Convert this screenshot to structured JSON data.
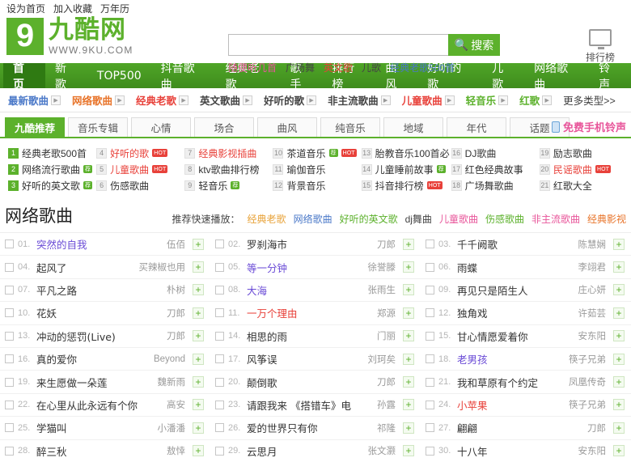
{
  "topbar": {
    "links": [
      "设为首页",
      "加入收藏",
      "万年历"
    ]
  },
  "logo": {
    "mark": "9",
    "cn": "九酷网",
    "en": "WWW.9KU.COM"
  },
  "search": {
    "value": "",
    "placeholder": "",
    "button_label": "搜索",
    "button_icon": "search-icon",
    "hotwords": [
      {
        "label": "随便听几首",
        "color": "#e8559a"
      },
      {
        "label": "广场舞",
        "color": "#444444"
      },
      {
        "label": "英文歌",
        "color": "#e8413a"
      },
      {
        "label": "儿歌",
        "color": "#444444"
      },
      {
        "label": "经典老歌500首",
        "color": "#4a78c8"
      }
    ]
  },
  "rank": {
    "icon": "monitor-icon",
    "label": "排行榜"
  },
  "mainnav": {
    "items": [
      {
        "label": "首页",
        "active": true
      },
      {
        "label": "新歌",
        "active": false
      },
      {
        "label": "TOP500",
        "active": false
      },
      {
        "label": "抖音歌曲",
        "active": false
      },
      {
        "label": "经典老歌",
        "active": false
      },
      {
        "label": "歌手",
        "active": false
      },
      {
        "label": "排行榜",
        "active": false
      },
      {
        "label": "曲风",
        "active": false
      },
      {
        "label": "好听的歌",
        "active": false
      },
      {
        "label": "儿歌",
        "active": false
      },
      {
        "label": "网络歌曲",
        "active": false
      },
      {
        "label": "铃声",
        "active": false
      }
    ]
  },
  "subnav": {
    "items": [
      {
        "label": "最新歌曲",
        "color": "#4a78c8",
        "icon": "play-icon"
      },
      {
        "label": "网络歌曲",
        "color": "#e8742a",
        "icon": "play-icon"
      },
      {
        "label": "经典老歌",
        "color": "#e8413a",
        "icon": "play-icon"
      },
      {
        "label": "英文歌曲",
        "color": "#444444",
        "icon": "play-icon"
      },
      {
        "label": "好听的歌",
        "color": "#444444",
        "icon": "play-icon"
      },
      {
        "label": "非主流歌曲",
        "color": "#444444",
        "icon": "play-icon"
      },
      {
        "label": "儿童歌曲",
        "color": "#e8413a",
        "icon": "play-icon"
      },
      {
        "label": "轻音乐",
        "color": "#5cb12c",
        "icon": "play-icon"
      },
      {
        "label": "红歌",
        "color": "#5cb12c",
        "icon": "play-icon"
      }
    ],
    "more": "更多类型>>"
  },
  "tabs": {
    "items": [
      {
        "label": "九酷推荐",
        "active": true
      },
      {
        "label": "音乐专辑",
        "active": false
      },
      {
        "label": "心情",
        "active": false
      },
      {
        "label": "场合",
        "active": false
      },
      {
        "label": "曲风",
        "active": false
      },
      {
        "label": "纯音乐",
        "active": false
      },
      {
        "label": "地域",
        "active": false
      },
      {
        "label": "年代",
        "active": false
      },
      {
        "label": "话题",
        "active": false
      }
    ],
    "ringtone": {
      "label": "免费手机铃声",
      "icon": "phone-icon"
    }
  },
  "grid": {
    "items": [
      {
        "num": "1",
        "label": "经典老歌500首",
        "green_num": true,
        "color": "#333333",
        "tag": ""
      },
      {
        "num": "2",
        "label": "网络流行歌曲",
        "green_num": true,
        "color": "#333333",
        "tag": "荐"
      },
      {
        "num": "3",
        "label": "好听的英文歌",
        "green_num": true,
        "color": "#333333",
        "tag": "荐"
      },
      {
        "num": "4",
        "label": "好听的歌",
        "green_num": false,
        "color": "#e8413a",
        "tag": "HOT"
      },
      {
        "num": "5",
        "label": "儿童歌曲",
        "green_num": false,
        "color": "#e8413a",
        "tag": "HOT"
      },
      {
        "num": "6",
        "label": "伤感歌曲",
        "green_num": false,
        "color": "#333333",
        "tag": ""
      },
      {
        "num": "7",
        "label": "经典影视插曲",
        "green_num": false,
        "color": "#e8413a",
        "tag": ""
      },
      {
        "num": "8",
        "label": "ktv歌曲排行榜",
        "green_num": false,
        "color": "#333333",
        "tag": ""
      },
      {
        "num": "9",
        "label": "轻音乐",
        "green_num": false,
        "color": "#333333",
        "tag": "荐"
      },
      {
        "num": "10",
        "label": "茶道音乐",
        "green_num": false,
        "color": "#333333",
        "tag": "荐HOT"
      },
      {
        "num": "11",
        "label": "瑜伽音乐",
        "green_num": false,
        "color": "#333333",
        "tag": ""
      },
      {
        "num": "12",
        "label": "背景音乐",
        "green_num": false,
        "color": "#333333",
        "tag": ""
      },
      {
        "num": "13",
        "label": "胎教音乐100首必",
        "green_num": false,
        "color": "#333333",
        "tag": ""
      },
      {
        "num": "14",
        "label": "儿童睡前故事",
        "green_num": false,
        "color": "#333333",
        "tag": "荐"
      },
      {
        "num": "15",
        "label": "抖音排行榜",
        "green_num": false,
        "color": "#333333",
        "tag": "HOT"
      },
      {
        "num": "16",
        "label": "DJ歌曲",
        "green_num": false,
        "color": "#333333",
        "tag": ""
      },
      {
        "num": "17",
        "label": "红色经典故事",
        "green_num": false,
        "color": "#333333",
        "tag": ""
      },
      {
        "num": "18",
        "label": "广场舞歌曲",
        "green_num": false,
        "color": "#333333",
        "tag": ""
      },
      {
        "num": "19",
        "label": "励志歌曲",
        "green_num": false,
        "color": "#333333",
        "tag": ""
      },
      {
        "num": "20",
        "label": "民谣歌曲",
        "green_num": false,
        "color": "#e8413a",
        "tag": "HOT"
      },
      {
        "num": "21",
        "label": "红歌大全",
        "green_num": false,
        "color": "#333333",
        "tag": ""
      }
    ]
  },
  "section": {
    "title": "网络歌曲",
    "quickplay_label": "推荐快速播放：",
    "quickplay_links": [
      {
        "label": "经典老歌",
        "color": "#e8a33a"
      },
      {
        "label": "网络歌曲",
        "color": "#4a78c8"
      },
      {
        "label": "好听的英文歌",
        "color": "#5cb12c"
      },
      {
        "label": "dj舞曲",
        "color": "#444444"
      },
      {
        "label": "儿童歌曲",
        "color": "#e8559a"
      },
      {
        "label": "伤感歌曲",
        "color": "#5cb12c"
      },
      {
        "label": "非主流歌曲",
        "color": "#e8559a"
      },
      {
        "label": "经典影视",
        "color": "#e8742a"
      }
    ]
  },
  "songs": [
    {
      "idx": "01.",
      "title": "突然的自我",
      "artist": "伍佰",
      "state": "visited"
    },
    {
      "idx": "02.",
      "title": "罗刹海市",
      "artist": "刀郎",
      "state": ""
    },
    {
      "idx": "03.",
      "title": "千千阙歌",
      "artist": "陈慧娴",
      "state": ""
    },
    {
      "idx": "04.",
      "title": "起风了",
      "artist": "买辣椒也用",
      "state": ""
    },
    {
      "idx": "05.",
      "title": "等一分钟",
      "artist": "徐誉滕",
      "state": "visited"
    },
    {
      "idx": "06.",
      "title": "雨蝶",
      "artist": "李翊君",
      "state": ""
    },
    {
      "idx": "07.",
      "title": "平凡之路",
      "artist": "朴树",
      "state": ""
    },
    {
      "idx": "08.",
      "title": "大海",
      "artist": "张雨生",
      "state": "visited"
    },
    {
      "idx": "09.",
      "title": "再见只是陌生人",
      "artist": "庄心妍",
      "state": ""
    },
    {
      "idx": "10.",
      "title": "花妖",
      "artist": "刀郎",
      "state": ""
    },
    {
      "idx": "11.",
      "title": "一万个理由",
      "artist": "郑源",
      "state": "hot"
    },
    {
      "idx": "12.",
      "title": "独角戏",
      "artist": "许茹芸",
      "state": ""
    },
    {
      "idx": "13.",
      "title": "冲动的惩罚(Live)",
      "artist": "刀郎",
      "state": ""
    },
    {
      "idx": "14.",
      "title": "相思的雨",
      "artist": "门丽",
      "state": ""
    },
    {
      "idx": "15.",
      "title": "甘心情愿爱着你",
      "artist": "安东阳",
      "state": ""
    },
    {
      "idx": "16.",
      "title": "真的爱你",
      "artist": "Beyond",
      "state": ""
    },
    {
      "idx": "17.",
      "title": "风筝误",
      "artist": "刘珂矣",
      "state": ""
    },
    {
      "idx": "18.",
      "title": "老男孩",
      "artist": "筷子兄弟",
      "state": "visited"
    },
    {
      "idx": "19.",
      "title": "来生愿做一朵莲",
      "artist": "魏新雨",
      "state": ""
    },
    {
      "idx": "20.",
      "title": "颠倒歌",
      "artist": "刀郎",
      "state": ""
    },
    {
      "idx": "21.",
      "title": "我和草原有个约定",
      "artist": "凤凰传奇",
      "state": ""
    },
    {
      "idx": "22.",
      "title": "在心里从此永远有个你",
      "artist": "高安",
      "state": ""
    },
    {
      "idx": "23.",
      "title": "请跟我来 《搭错车》电",
      "artist": "孙露",
      "state": ""
    },
    {
      "idx": "24.",
      "title": "小苹果",
      "artist": "筷子兄弟",
      "state": "hot"
    },
    {
      "idx": "25.",
      "title": "学猫叫",
      "artist": "小潘潘",
      "state": ""
    },
    {
      "idx": "26.",
      "title": "爱的世界只有你",
      "artist": "祁隆",
      "state": ""
    },
    {
      "idx": "27.",
      "title": "翩翩",
      "artist": "刀郎",
      "state": ""
    },
    {
      "idx": "28.",
      "title": "醉三秋",
      "artist": "敖悻",
      "state": ""
    },
    {
      "idx": "29.",
      "title": "云思月",
      "artist": "张文灏",
      "state": ""
    },
    {
      "idx": "30.",
      "title": "十八年",
      "artist": "安东阳",
      "state": ""
    }
  ],
  "add_icon": "+"
}
